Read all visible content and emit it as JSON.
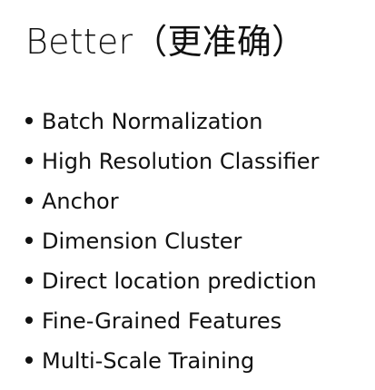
{
  "title": "Better（更准确）",
  "bullets": [
    "Batch Normalization",
    "High Resolution Classifier",
    "Anchor",
    "Dimension Cluster",
    "Direct location prediction",
    "Fine-Grained Features",
    "Multi-Scale Training"
  ]
}
